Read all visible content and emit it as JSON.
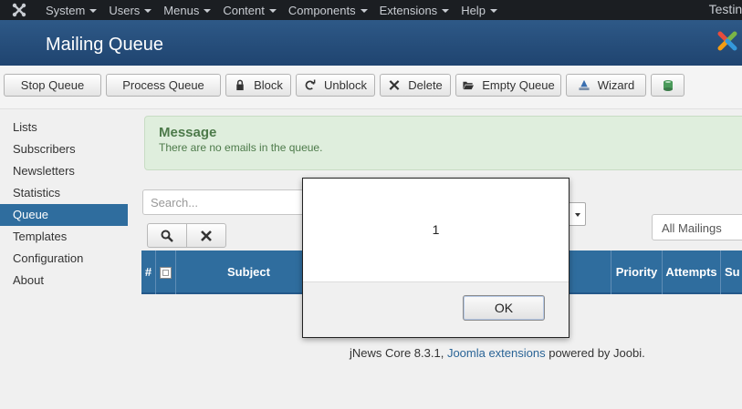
{
  "navbar": {
    "menus": [
      "System",
      "Users",
      "Menus",
      "Content",
      "Components",
      "Extensions",
      "Help"
    ],
    "site_name": "Testing"
  },
  "header": {
    "title": "Mailing Queue"
  },
  "toolbar": {
    "stop_queue": "Stop Queue",
    "process_queue": "Process Queue",
    "block": "Block",
    "unblock": "Unblock",
    "delete": "Delete",
    "empty_queue": "Empty Queue",
    "wizard": "Wizard"
  },
  "sidebar": {
    "items": [
      {
        "label": "Lists",
        "active": false
      },
      {
        "label": "Subscribers",
        "active": false
      },
      {
        "label": "Newsletters",
        "active": false
      },
      {
        "label": "Statistics",
        "active": false
      },
      {
        "label": "Queue",
        "active": true
      },
      {
        "label": "Templates",
        "active": false
      },
      {
        "label": "Configuration",
        "active": false
      },
      {
        "label": "About",
        "active": false
      }
    ]
  },
  "message": {
    "heading": "Message",
    "body": "There are no emails in the queue."
  },
  "filters": {
    "search_placeholder": "Search...",
    "mailings_selected": "All Mailings"
  },
  "table": {
    "columns": [
      "#",
      "Subject",
      "Priority",
      "Attempts",
      "Su"
    ]
  },
  "footer": {
    "prefix": "jNews Core 8.3.1, ",
    "link": "Joomla extensions",
    "suffix": " powered by Joobi."
  },
  "dialog": {
    "message": "1",
    "ok_label": "OK"
  },
  "colors": {
    "navbar_bg": "#1b1e22",
    "header_bg": "#2a5482",
    "accent": "#2f6d9e",
    "message_bg": "#dfeedd"
  }
}
